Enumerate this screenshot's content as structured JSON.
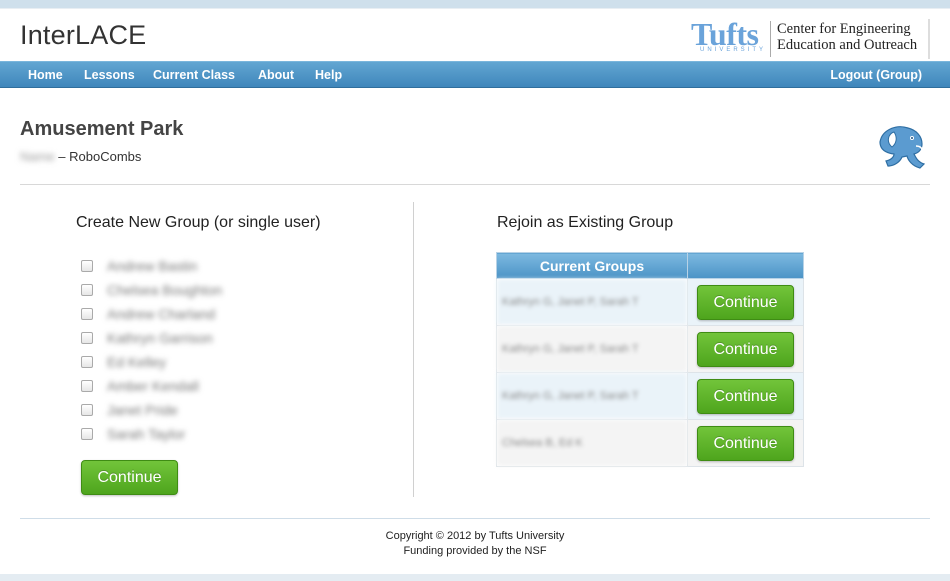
{
  "app": {
    "title": "InterLACE"
  },
  "logo": {
    "wordmark": "Tufts",
    "subtext": "UNIVERSITY",
    "line1": "Center for Engineering",
    "line2": "Education and Outreach"
  },
  "nav": {
    "items": [
      "Home",
      "Lessons",
      "Current Class",
      "About",
      "Help"
    ],
    "logout": "Logout (Group)"
  },
  "page": {
    "title": "Amusement Park",
    "owner": "Name",
    "separator": " – ",
    "class_name": "RoboCombs"
  },
  "create_group": {
    "heading": "Create New Group (or single user)",
    "users": [
      "Andrew Bastin",
      "Chelsea Boughton",
      "Andrew Charland",
      "Kathryn Garrison",
      "Ed Kelley",
      "Amber Kendall",
      "Janet Pride",
      "Sarah Taylor"
    ],
    "continue_label": "Continue"
  },
  "rejoin": {
    "heading": "Rejoin as Existing Group",
    "table_header": "Current Groups",
    "groups": [
      {
        "members": "Kathryn G, Janet P, Sarah T",
        "button": "Continue"
      },
      {
        "members": "Kathryn G, Janet P, Sarah T",
        "button": "Continue"
      },
      {
        "members": "Kathryn G, Janet P, Sarah T",
        "button": "Continue"
      },
      {
        "members": "Chelsea B, Ed K",
        "button": "Continue"
      }
    ]
  },
  "footer": {
    "copyright": "Copyright © 2012 by Tufts University",
    "funding": "Funding provided by the NSF"
  },
  "colors": {
    "nav_blue": "#4b93c6",
    "button_green": "#5cb327",
    "logo_blue": "#6aa3da"
  }
}
